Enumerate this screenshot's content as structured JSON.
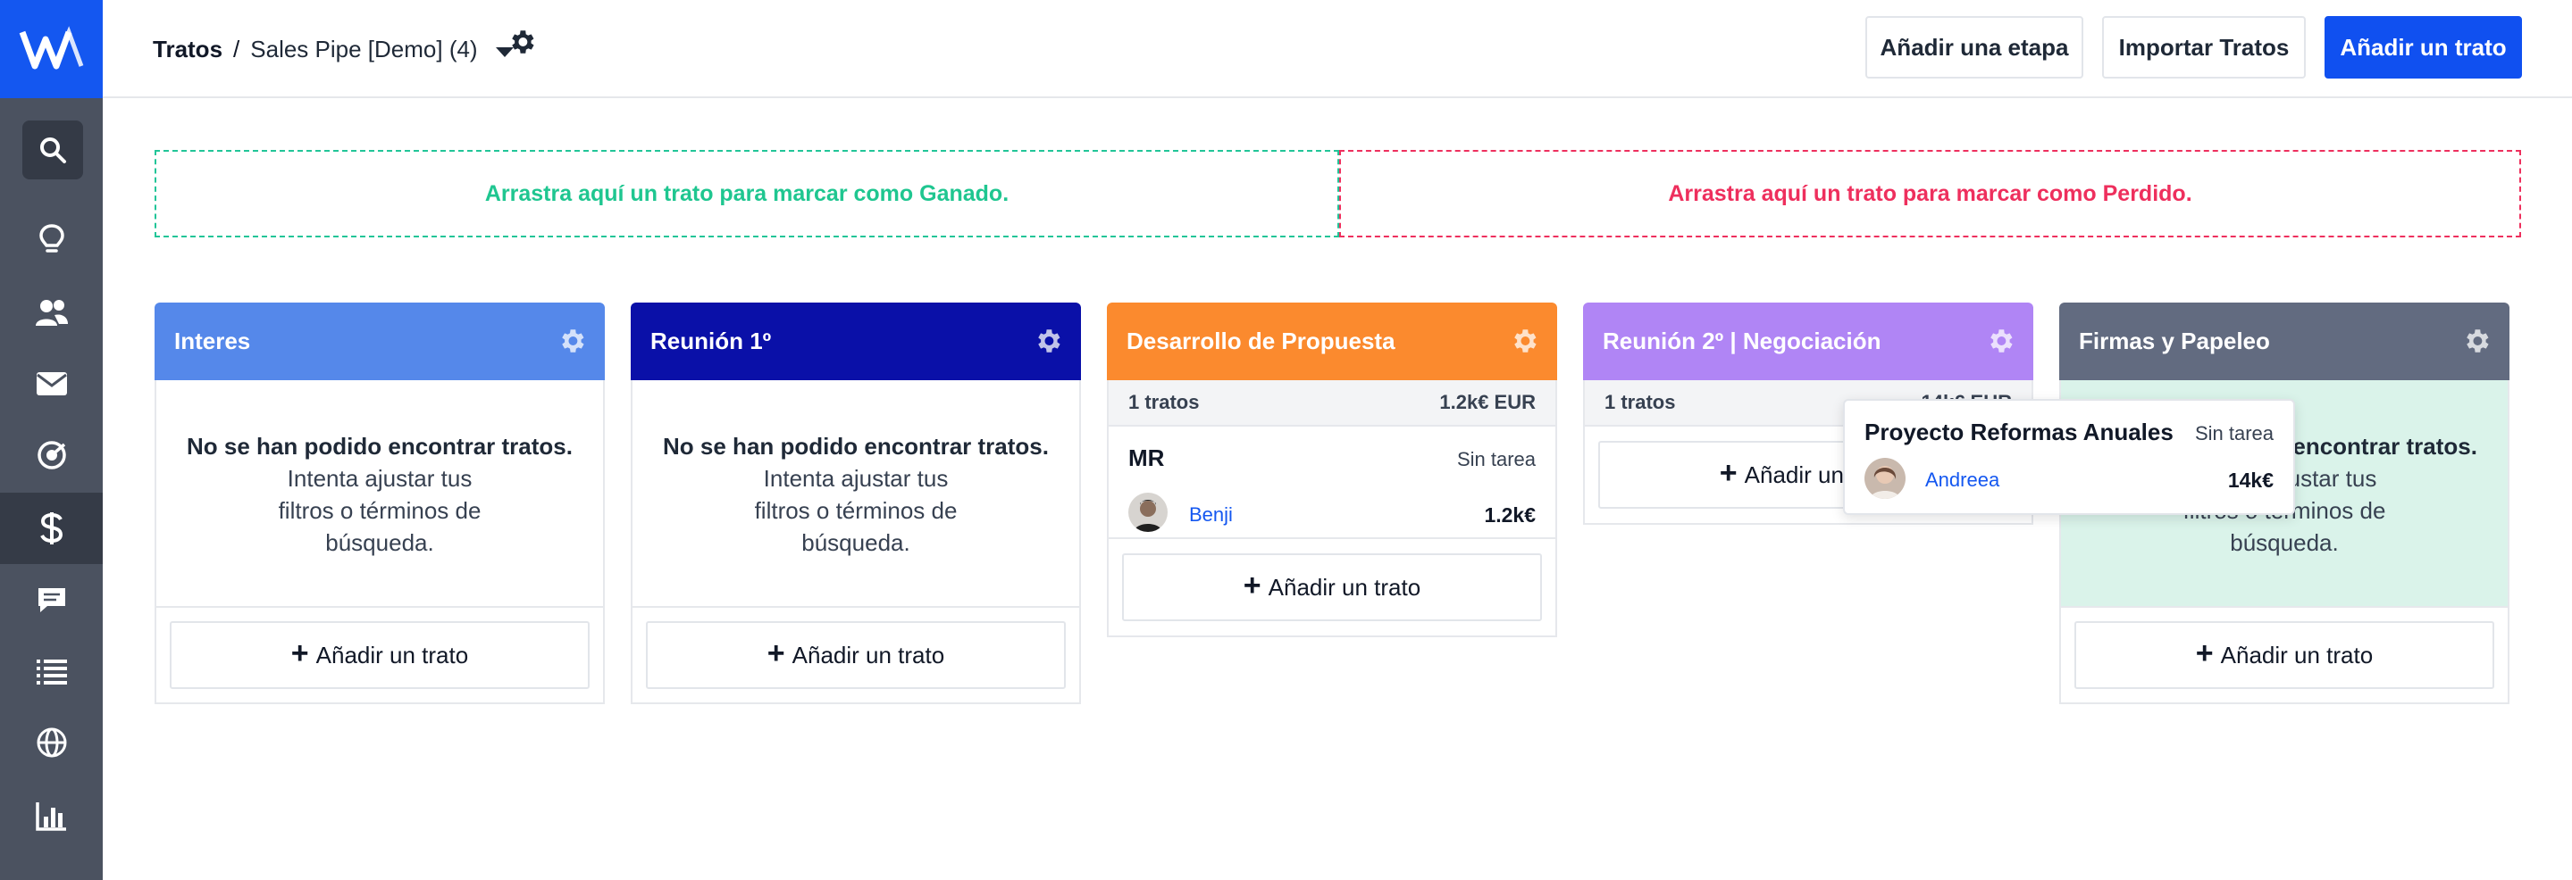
{
  "colors": {
    "brand": "#1457f0",
    "sidebar": "#4b5260",
    "won": "#1fc690",
    "lost": "#ee2f5d",
    "stage_interes": "#5588ea",
    "stage_reunion1": "#0a10a8",
    "stage_desarrollo": "#fb8a2e",
    "stage_reunion2": "#b085f5",
    "stage_firmas": "#626b80"
  },
  "sidebar": {
    "items": [
      {
        "icon": "search-icon"
      },
      {
        "icon": "lightbulb-icon"
      },
      {
        "icon": "contacts-icon"
      },
      {
        "icon": "mail-icon"
      },
      {
        "icon": "target-icon"
      },
      {
        "icon": "dollar-icon",
        "active": true
      },
      {
        "icon": "chat-icon"
      },
      {
        "icon": "list-icon"
      },
      {
        "icon": "globe-icon"
      },
      {
        "icon": "bar-chart-icon"
      }
    ]
  },
  "header": {
    "section": "Tratos",
    "separator": "/",
    "pipeline": "Sales Pipe [Demo] (4)",
    "buttons": {
      "add_stage": "Añadir una etapa",
      "import": "Importar Tratos",
      "add_deal": "Añadir un trato"
    }
  },
  "dropzones": {
    "won": "Arrastra aquí un trato para marcar como Ganado.",
    "lost": "Arrastra aquí un trato para marcar como Perdido."
  },
  "empty": {
    "title": "No se han podido encontrar tratos.",
    "line1": "Intenta ajustar tus",
    "line2": "filtros o términos de",
    "line3": "búsqueda."
  },
  "add_deal_label": "Añadir un trato",
  "stages": [
    {
      "name": "Interes"
    },
    {
      "name": "Reunión 1º"
    },
    {
      "name": "Desarrollo de Propuesta",
      "count": "1 tratos",
      "total": "1.2k€ EUR",
      "deal": {
        "name": "MR",
        "task": "Sin tarea",
        "owner": "Benji",
        "amount": "1.2k€"
      }
    },
    {
      "name": "Reunión 2º | Negociación",
      "count": "1 tratos",
      "total": "14k€ EUR"
    },
    {
      "name": "Firmas y Papeleo"
    }
  ],
  "dragging_deal": {
    "name": "Proyecto Reformas Anuales",
    "task": "Sin tarea",
    "owner": "Andreea",
    "amount": "14k€"
  }
}
